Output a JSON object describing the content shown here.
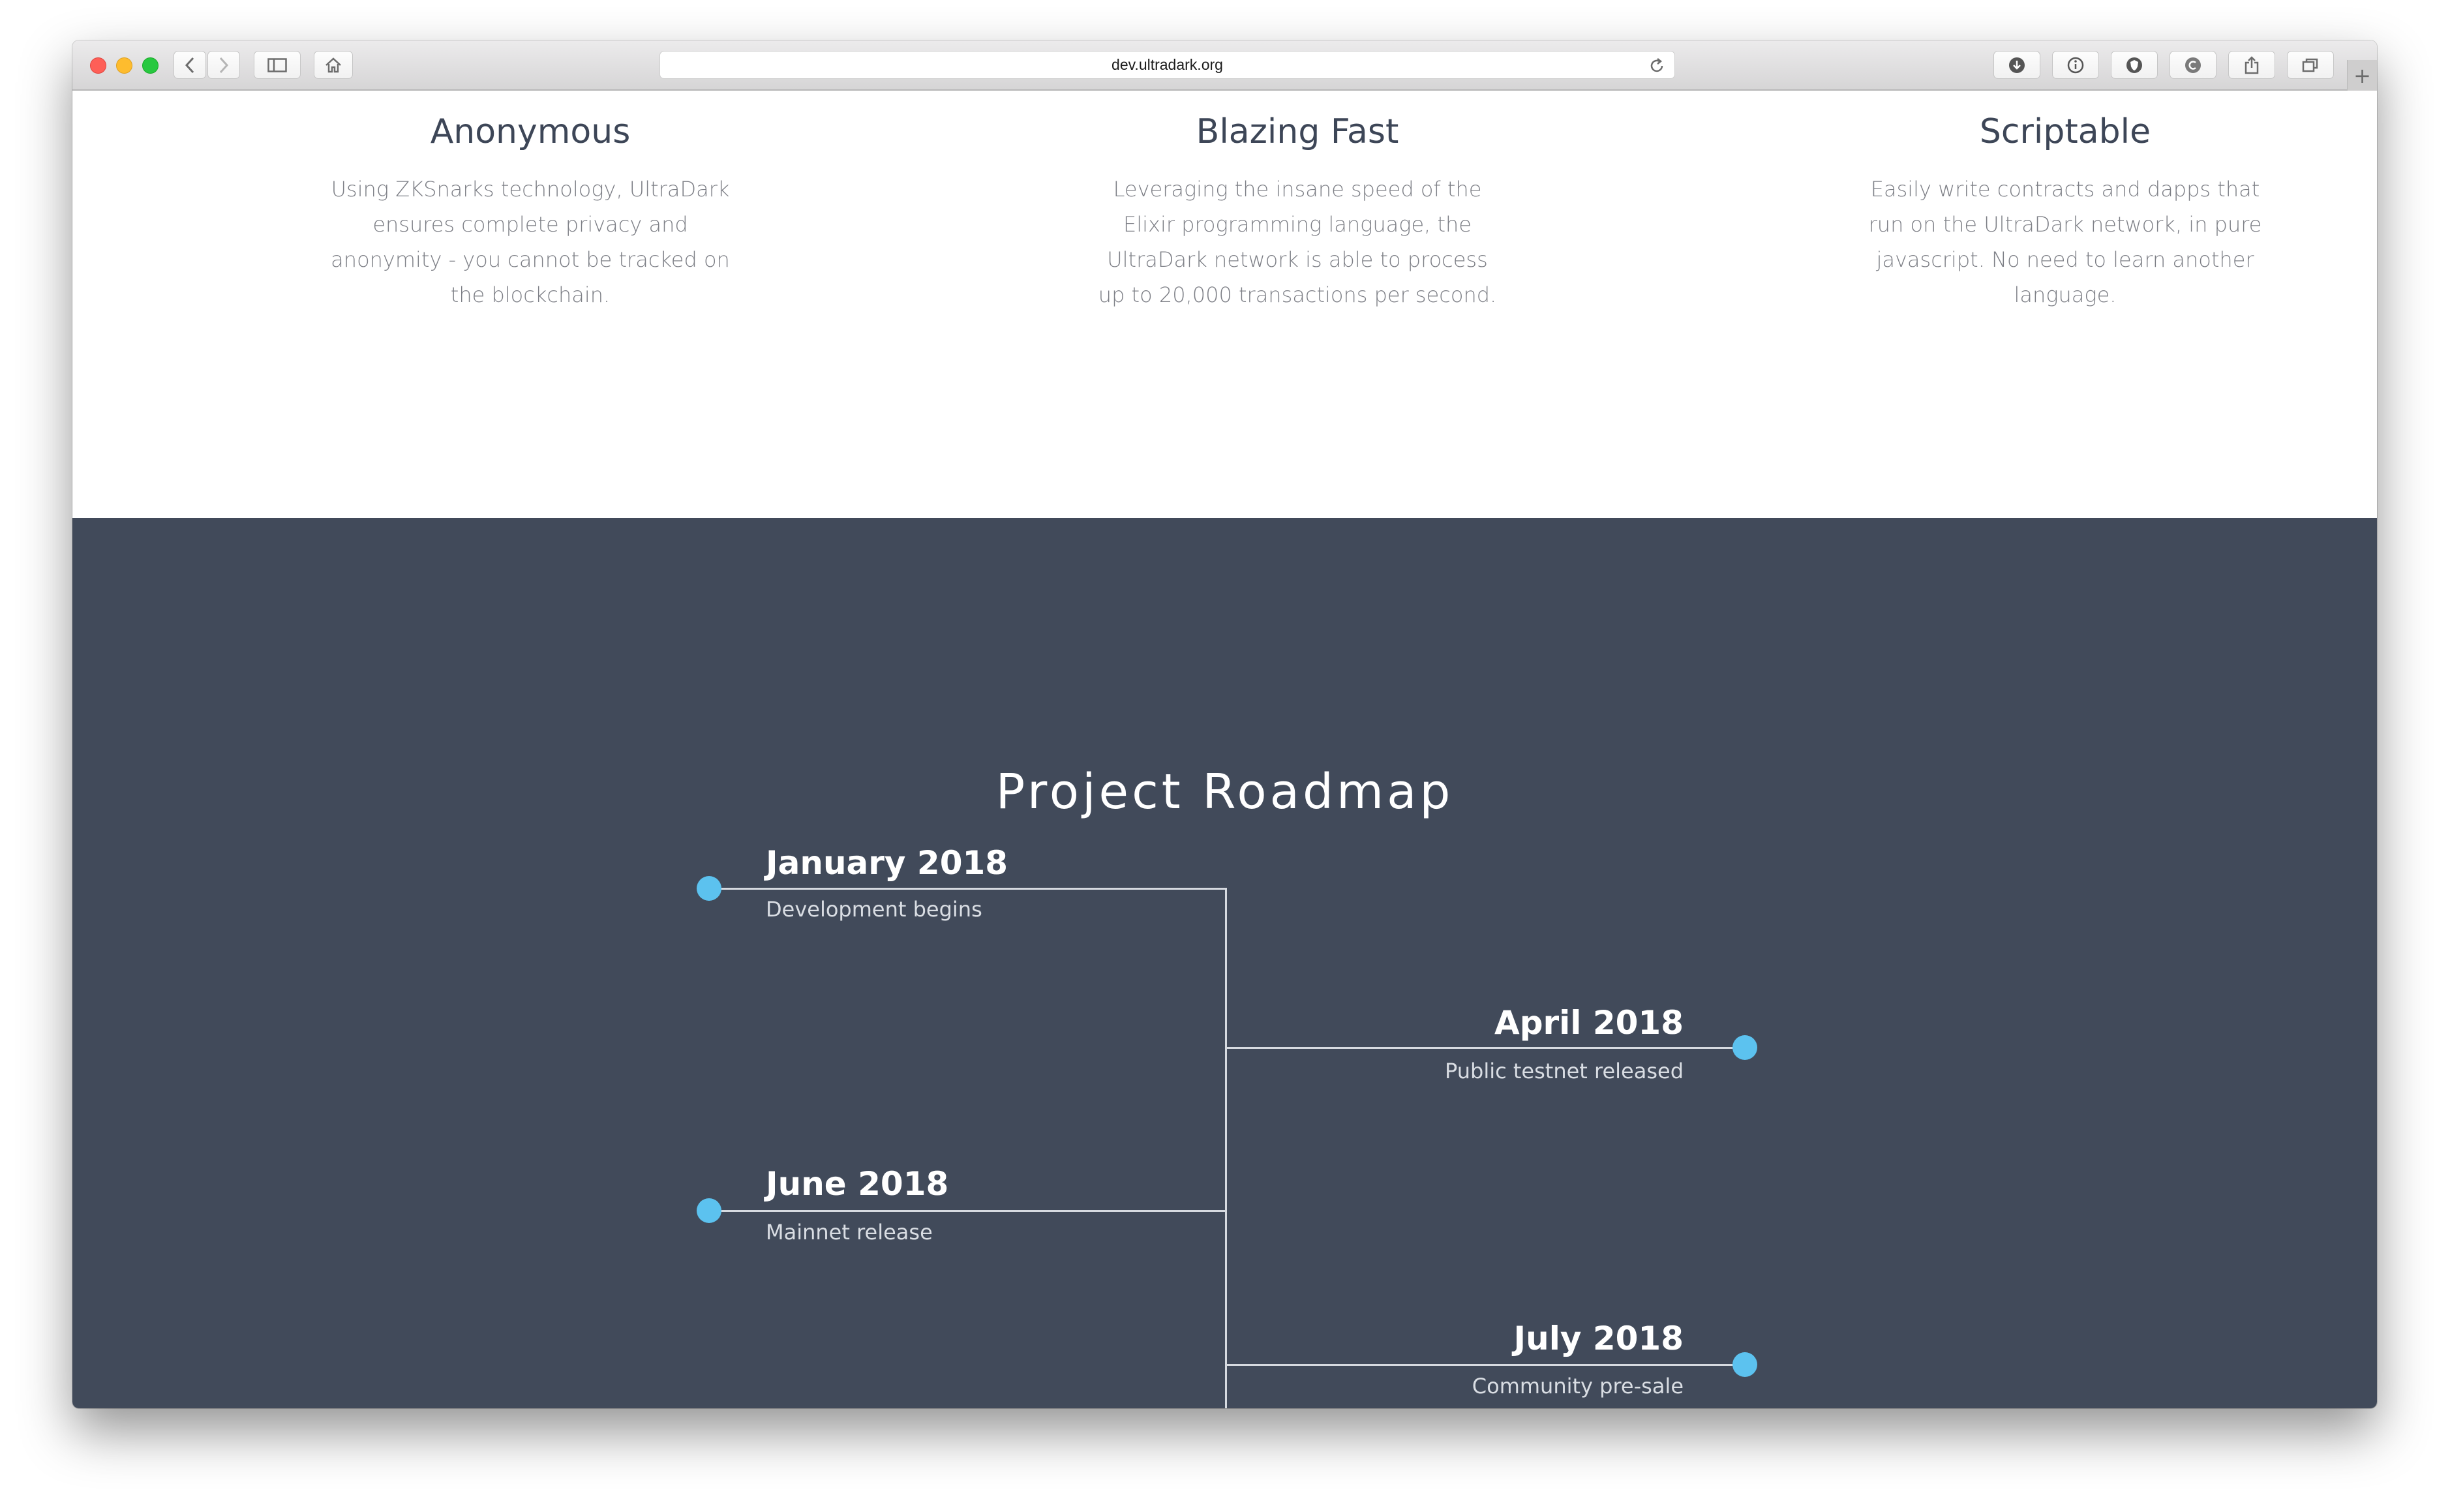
{
  "browser": {
    "url": "dev.ultradark.org",
    "new_tab_symbol": "+"
  },
  "features": [
    {
      "title": "Anonymous",
      "text": "Using ZKSnarks technology, UltraDark ensures complete privacy and anonymity - you cannot be tracked on the blockchain."
    },
    {
      "title": "Blazing Fast",
      "text": "Leveraging the insane speed of the Elixir programming language, the UltraDark network is able to process up to 20,000 transactions per second."
    },
    {
      "title": "Scriptable",
      "text": "Easily write contracts and dapps that run on the UltraDark network, in pure javascript. No need to learn another language."
    }
  ],
  "roadmap": {
    "title": "Project Roadmap",
    "milestones": [
      {
        "date": "January 2018",
        "description": "Development begins",
        "side": "left"
      },
      {
        "date": "April 2018",
        "description": "Public testnet released",
        "side": "right"
      },
      {
        "date": "June 2018",
        "description": "Mainnet release",
        "side": "left"
      },
      {
        "date": "July 2018",
        "description": "Community pre-sale",
        "side": "right"
      }
    ]
  },
  "colors": {
    "roadmap_background": "#414a5a",
    "accent_dot": "#5cc2ef",
    "feature_title": "#3d4657",
    "feature_text": "#7d7f86"
  }
}
